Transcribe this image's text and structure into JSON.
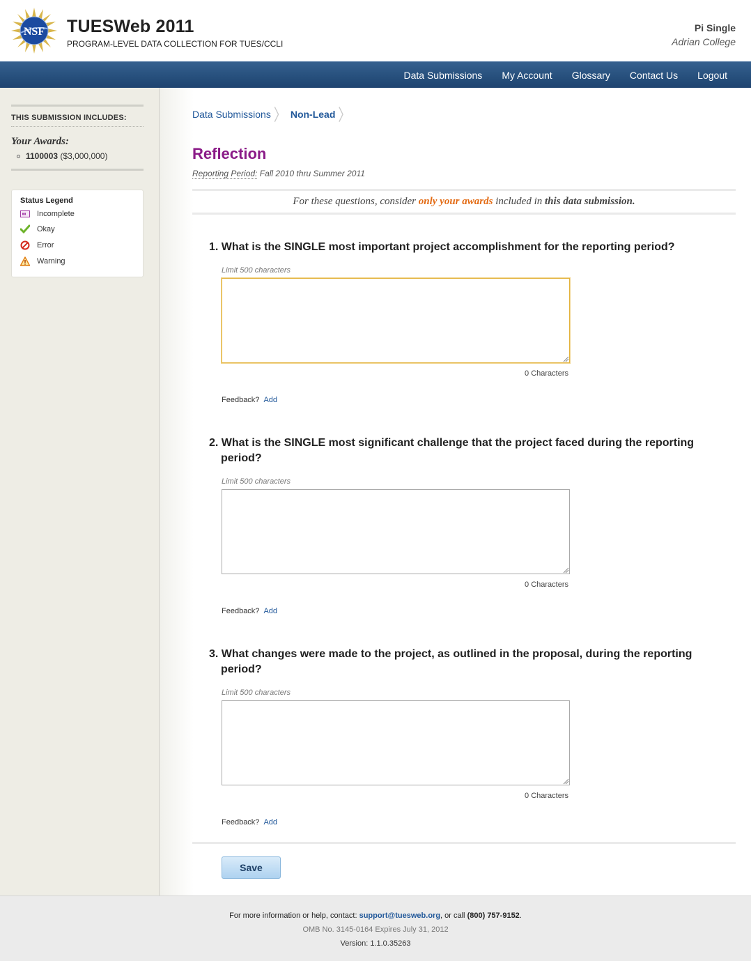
{
  "header": {
    "title": "TUESWeb 2011",
    "subtitle": "PROGRAM-LEVEL DATA COLLECTION FOR TUES/CCLI",
    "logo_text": "NSF",
    "user_name": "Pi Single",
    "user_org": "Adrian College"
  },
  "nav": [
    "Data Submissions",
    "My Account",
    "Glossary",
    "Contact Us",
    "Logout"
  ],
  "sidebar": {
    "title": "THIS SUBMISSION INCLUDES:",
    "awards_label": "Your Awards:",
    "award_id": "1100003",
    "award_amount": "($3,000,000)",
    "legend_title": "Status Legend",
    "legend": [
      "Incomplete",
      "Okay",
      "Error",
      "Warning"
    ]
  },
  "breadcrumb": {
    "link": "Data Submissions",
    "current": "Non-Lead"
  },
  "page": {
    "title": "Reflection",
    "rp_label": "Reporting Period:",
    "rp_value": "Fall 2010 thru Summer 2011",
    "notice_pre": "For these questions, consider",
    "notice_hl": "only your awards",
    "notice_mid": "included in",
    "notice_em": "this data submission."
  },
  "questions": [
    {
      "text": "1. What is the SINGLE most important project accomplishment for the reporting period?",
      "limit": "Limit 500 characters",
      "value": "",
      "count": "0 Characters",
      "feedback": "Feedback?",
      "add": "Add"
    },
    {
      "text": "2. What is the SINGLE most significant challenge that the project faced during the reporting period?",
      "limit": "Limit 500 characters",
      "value": "",
      "count": "0 Characters",
      "feedback": "Feedback?",
      "add": "Add"
    },
    {
      "text": "3. What changes were made to the project, as outlined in the proposal, during the reporting period?",
      "limit": "Limit 500 characters",
      "value": "",
      "count": "0 Characters",
      "feedback": "Feedback?",
      "add": "Add"
    }
  ],
  "save_label": "Save",
  "footer": {
    "help_pre": "For more information or help, contact:",
    "email": "support@tuesweb.org",
    "help_mid": ", or call",
    "phone": "(800) 757-9152",
    "help_end": ".",
    "omb": "OMB No. 3145-0164 Expires July 31, 2012",
    "version": "Version: 1.1.0.35263"
  },
  "colors": {
    "nav_bar": "#27507d",
    "title_purple": "#8b1c88",
    "link_blue": "#21589a",
    "highlight_orange": "#e36b14"
  }
}
